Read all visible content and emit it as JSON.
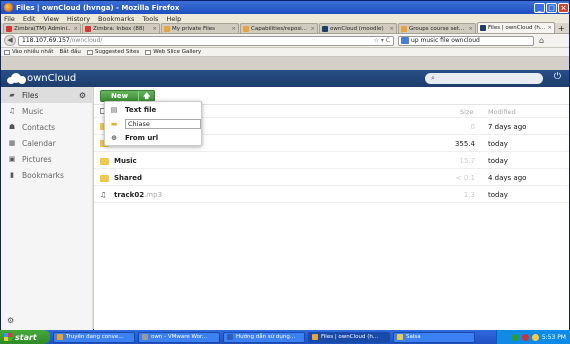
{
  "window": {
    "title": "Files | ownCloud (hvnga) - Mozilla Firefox"
  },
  "menubar": [
    "File",
    "Edit",
    "View",
    "History",
    "Bookmarks",
    "Tools",
    "Help"
  ],
  "tabs": [
    {
      "label": "Zimbra(TM) Admini...",
      "color": "#d33"
    },
    {
      "label": "Zimbra: Inbox (88)",
      "color": "#d33"
    },
    {
      "label": "My private Files",
      "color": "#e8a33a"
    },
    {
      "label": "Capabilities/reposi...",
      "color": "#e8a33a"
    },
    {
      "label": "ownCloud (moodle)",
      "color": "#1d3d6b"
    },
    {
      "label": "Groups course set...",
      "color": "#e8a33a"
    },
    {
      "label": "Files | ownCloud (h...",
      "color": "#1d3d6b",
      "active": true
    }
  ],
  "navbar": {
    "url_host": "118.107.69.157",
    "url_path": "/owncloud/",
    "search_value": "up music file owncloud"
  },
  "bookmarks": [
    "Vào nhiều nhất",
    "Bắt đầu",
    "Suggested Sites",
    "Web Slice Gallery"
  ],
  "owncloud": {
    "logo_text": "ownCloud",
    "search_placeholder": "",
    "sidebar": [
      {
        "label": "Files",
        "icon": "folder-icon",
        "active": true
      },
      {
        "label": "Music",
        "icon": "music-note-icon"
      },
      {
        "label": "Contacts",
        "icon": "contacts-icon"
      },
      {
        "label": "Calendar",
        "icon": "calendar-icon"
      },
      {
        "label": "Pictures",
        "icon": "image-icon"
      },
      {
        "label": "Bookmarks",
        "icon": "bookmark-icon"
      }
    ],
    "new_button": "New",
    "new_menu": {
      "text_file": "Text file",
      "folder_input_value": "Chiase",
      "from_url": "From url"
    },
    "table_header": {
      "size": "Size",
      "modified": "Modified"
    },
    "files": [
      {
        "name": "",
        "ext": "",
        "type": "folder",
        "size": "0",
        "modified": "7 days ago"
      },
      {
        "name": "",
        "ext": "",
        "type": "folder",
        "size": "355.4",
        "modified": "today"
      },
      {
        "name": "Music",
        "ext": "",
        "type": "folder",
        "size": "15.7",
        "modified": "today"
      },
      {
        "name": "Shared",
        "ext": "",
        "type": "folder",
        "size": "< 0.1",
        "modified": "4 days ago"
      },
      {
        "name": "track02",
        "ext": ".mp3",
        "type": "audio",
        "size": "1.3",
        "modified": "today"
      }
    ]
  },
  "taskbar": {
    "start": "start",
    "buttons": [
      {
        "label": "Truyền đang conve...",
        "color": "#f0a020"
      },
      {
        "label": "own - VMware Wor...",
        "color": "#999"
      },
      {
        "label": "Hướng dẫn sử dụng...",
        "color": "#2b5fb8"
      },
      {
        "label": "Files | ownCloud (h...",
        "color": "#e8a33a",
        "active": true
      },
      {
        "label": "Salsa",
        "color": "#f1c94a"
      }
    ],
    "clock": "5:53 PM"
  }
}
